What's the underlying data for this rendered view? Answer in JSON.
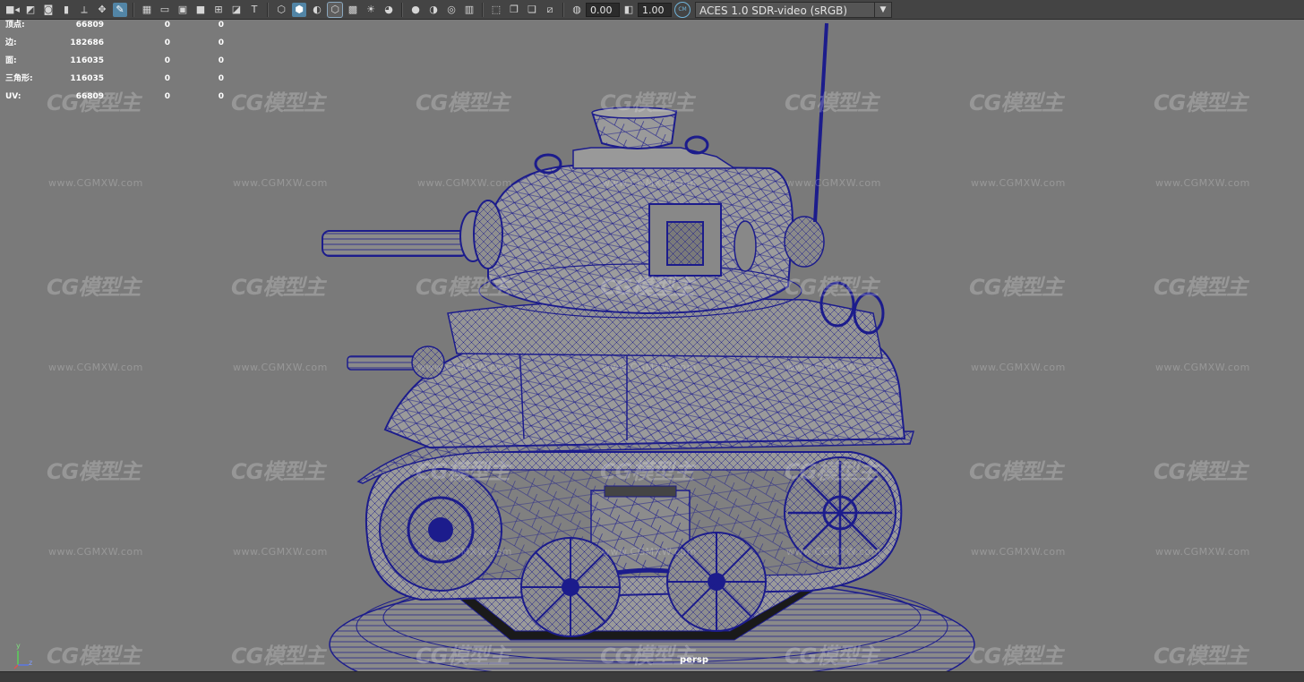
{
  "toolbar": {
    "exposure_value": "0.00",
    "gamma_value": "1.00",
    "color_space": "ACES 1.0 SDR-video (sRGB)"
  },
  "hud": [
    {
      "label": "顶点:",
      "v1": "66809",
      "v2": "0",
      "v3": "0"
    },
    {
      "label": "边:",
      "v1": "182686",
      "v2": "0",
      "v3": "0"
    },
    {
      "label": "面:",
      "v1": "116035",
      "v2": "0",
      "v3": "0"
    },
    {
      "label": "三角形:",
      "v1": "116035",
      "v2": "0",
      "v3": "0"
    },
    {
      "label": "UV:",
      "v1": "66809",
      "v2": "0",
      "v3": "0"
    }
  ],
  "viewport": {
    "camera": "persp",
    "watermark_logo": "CG模型主",
    "watermark_url": "www.CGMXW.com"
  },
  "axis": {
    "y": "y",
    "z": "z"
  },
  "colors": {
    "background": "#7a7a7a",
    "wire": "#1c1c8c",
    "toolbar": "#444444",
    "active_tool": "#5285a6"
  }
}
